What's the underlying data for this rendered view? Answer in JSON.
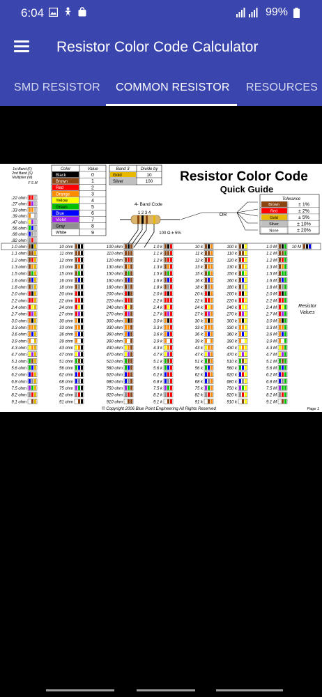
{
  "status_bar": {
    "time": "6:04",
    "battery": "99%"
  },
  "app_bar": {
    "title": "Resistor Color Code Calculator"
  },
  "tabs": [
    {
      "label": "SMD RESISTOR",
      "active": false
    },
    {
      "label": "COMMON RESISTOR",
      "active": true
    },
    {
      "label": "RESOURCES",
      "active": false
    }
  ],
  "guide": {
    "title": "Resistor Color Code",
    "subtitle": "Quick Guide",
    "band_header": [
      "1st Band (F)",
      "2nd Band (S)",
      "Multiplier (M)"
    ],
    "fsm": "F S M",
    "color_header": "Color",
    "value_header": "Value",
    "colors": [
      {
        "name": "Black",
        "value": "0",
        "hex": "#000000",
        "text": "#ffffff"
      },
      {
        "name": "Brown",
        "value": "1",
        "hex": "#8b4513",
        "text": "#ffffff"
      },
      {
        "name": "Red",
        "value": "2",
        "hex": "#ff0000",
        "text": "#ffffff"
      },
      {
        "name": "Orange",
        "value": "3",
        "hex": "#ff8c00",
        "text": "#ffffff"
      },
      {
        "name": "Yellow",
        "value": "4",
        "hex": "#ffff00",
        "text": "#000000"
      },
      {
        "name": "Green",
        "value": "5",
        "hex": "#00c000",
        "text": "#000000"
      },
      {
        "name": "Blue",
        "value": "6",
        "hex": "#0000ff",
        "text": "#ffffff"
      },
      {
        "name": "Violet",
        "value": "7",
        "hex": "#a020f0",
        "text": "#ffffff"
      },
      {
        "name": "Gray",
        "value": "8",
        "hex": "#909090",
        "text": "#000000"
      },
      {
        "name": "White",
        "value": "9",
        "hex": "#ffffff",
        "text": "#000000"
      }
    ],
    "band3_header": "Band 3",
    "divide_header": "Divide by",
    "band3": [
      {
        "name": "Gold",
        "value": "10",
        "hex": "#e6b800"
      },
      {
        "name": "Silver",
        "value": "100",
        "hex": "#c0c0c0"
      }
    ],
    "four_band_label": "4- Band Code",
    "band_numbers": "1 2 3 4",
    "example_value": "100 Ω ± 5%",
    "or_label": "OR",
    "tolerance_header": "Tolerance",
    "tolerance": [
      {
        "name": "Brown",
        "value": "± 1%",
        "hex": "#8b4513"
      },
      {
        "name": "Red",
        "value": "± 2%",
        "hex": "#ff0000"
      },
      {
        "name": "Gold",
        "value": "± 5%",
        "hex": "#e6b800"
      },
      {
        "name": "Silver",
        "value": "± 10%",
        "hex": "#c0c0c0"
      },
      {
        "name": "None",
        "value": "± 20%",
        "hex": "#ffffff"
      }
    ],
    "small_values": [
      ".22 ohm",
      ".27 ohm",
      ".33 ohm",
      ".39 ohm",
      ".47 ohm",
      ".56 ohm",
      ".68 ohm",
      ".82 ohm"
    ],
    "bases": [
      "1.0",
      "1.1",
      "1.2",
      "1.3",
      "1.5",
      "1.6",
      "1.8",
      "2.0",
      "2.2",
      "2.4",
      "2.7",
      "3.0",
      "3.3",
      "3.6",
      "3.9",
      "4.3",
      "4.7",
      "5.1",
      "5.6",
      "6.2",
      "6.8",
      "7.5",
      "8.2",
      "9.1"
    ],
    "suffixes": [
      " ohm",
      "0 ohm",
      "00 ohm",
      " k",
      "0 k",
      "00 k",
      " M"
    ],
    "last_value": "10 M",
    "resistor_values_label": [
      "Resistor",
      "Values"
    ],
    "copyright": "© Copyright 2006 Blue Point Engineering   All Rights Reserved",
    "page": "Page 1"
  }
}
